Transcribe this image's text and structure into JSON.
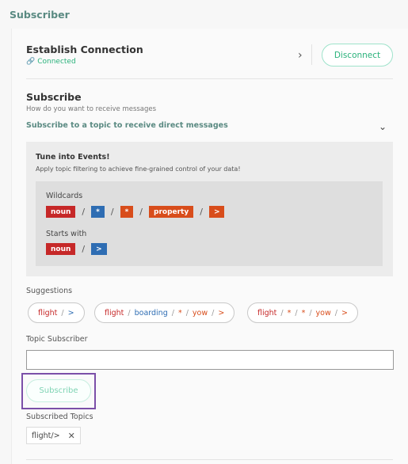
{
  "page": {
    "title": "Subscriber"
  },
  "connection": {
    "title": "Establish Connection",
    "status": "Connected",
    "status_icon": "link-icon",
    "disconnect_label": "Disconnect"
  },
  "subscribe": {
    "title": "Subscribe",
    "description": "How do you want to receive messages",
    "mode_label": "Subscribe to a topic to receive direct messages"
  },
  "events": {
    "title": "Tune into Events!",
    "description": "Apply topic filtering to achieve fine-grained control of your data!",
    "wildcards_label": "Wildcards",
    "starts_with_label": "Starts with",
    "wildcard_tokens": [
      {
        "text": "noun",
        "color": "#c62828"
      },
      {
        "text": "*",
        "color": "#2e6db3"
      },
      {
        "text": "*",
        "color": "#d84d1b"
      },
      {
        "text": "property",
        "color": "#d84d1b"
      },
      {
        "text": ">",
        "color": "#d84d1b"
      }
    ],
    "starts_tokens": [
      {
        "text": "noun",
        "color": "#c62828"
      },
      {
        "text": ">",
        "color": "#2e6db3"
      }
    ],
    "separator": "/"
  },
  "suggestions": {
    "label": "Suggestions",
    "items": [
      [
        "flight",
        "/",
        ">"
      ],
      [
        "flight",
        "/",
        "boarding",
        "/",
        "*",
        "/",
        "yow",
        "/",
        ">"
      ],
      [
        "flight",
        "/",
        "*",
        "/",
        "*",
        "/",
        "yow",
        "/",
        ">"
      ]
    ]
  },
  "topic_subscriber": {
    "label": "Topic Subscriber",
    "value": "",
    "subscribe_label": "Subscribe"
  },
  "subscribed_topics": {
    "label": "Subscribed Topics",
    "items": [
      "flight/>"
    ],
    "remove_icon": "close-icon"
  },
  "colors": {
    "accent": "#2ab27b",
    "heading": "#5a8a82",
    "noun": "#c62828",
    "wildcard": "#2e6db3",
    "property": "#d84d1b",
    "focus": "#7b4fa8"
  }
}
